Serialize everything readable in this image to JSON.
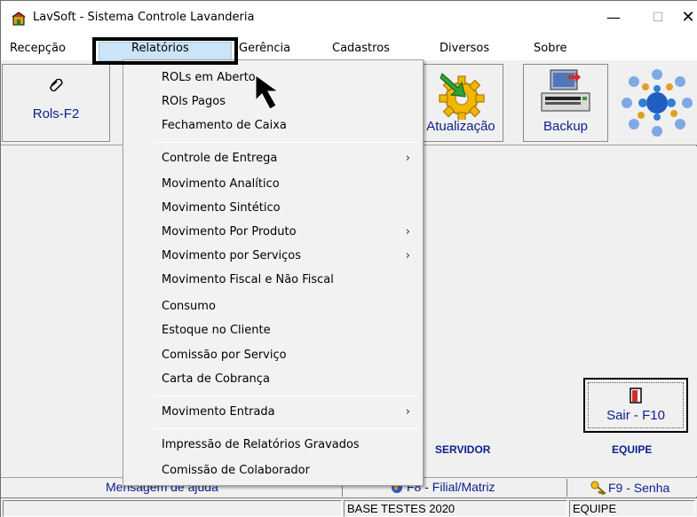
{
  "window": {
    "title": "LavSoft - Sistema Controle Lavanderia",
    "minimize": "—",
    "maximize": "☐",
    "close": "✕"
  },
  "menubar": {
    "items": [
      "Recepção",
      "Relatórios",
      "Gerência",
      "Cadastros",
      "Diversos",
      "Sobre"
    ],
    "active": "Relatórios"
  },
  "toolbar": {
    "rols": "Rols-F2",
    "atualizacao": "Atualização",
    "backup": "Backup"
  },
  "dropdown": {
    "items": [
      {
        "label": "ROLs em Aberto",
        "submenu": false
      },
      {
        "label": "ROls Pagos",
        "submenu": false
      },
      {
        "label": "Fechamento de Caixa",
        "submenu": false
      },
      {
        "label": "Controle de Entrega",
        "submenu": true
      },
      {
        "label": "Movimento Analítico",
        "submenu": false
      },
      {
        "label": "Movimento Sintético",
        "submenu": false
      },
      {
        "label": "Movimento Por Produto",
        "submenu": true
      },
      {
        "label": "Movimento por Serviços",
        "submenu": true
      },
      {
        "label": "Movimento Fiscal e Não Fiscal",
        "submenu": false
      },
      {
        "label": "Consumo",
        "submenu": false
      },
      {
        "label": "Estoque no Cliente",
        "submenu": false
      },
      {
        "label": "Comissão por Serviço",
        "submenu": false
      },
      {
        "label": "Carta de Cobrança",
        "submenu": false
      },
      {
        "label": "Movimento Entrada",
        "submenu": true
      },
      {
        "label": "Impressão de Relatórios Gravados",
        "submenu": false
      },
      {
        "label": "Comissão de Colaborador",
        "submenu": false
      }
    ],
    "arrow": "›"
  },
  "main": {
    "sair": "Sair - F10",
    "servidor": "SERVIDOR",
    "equipe": "EQUIPE"
  },
  "statusbar": {
    "help": "Mensagem de ajuda",
    "f8": "F8 - Filial/Matriz",
    "f9": "F9 - Senha",
    "database": "BASE TESTES 2020",
    "team": "EQUIPE"
  },
  "colors": {
    "label_blue": "#0b1f8c",
    "menu_highlight": "#cce4f7"
  }
}
